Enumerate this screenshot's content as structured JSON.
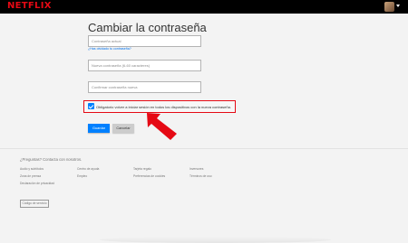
{
  "header": {
    "logo_text": "NETFLIX",
    "avatar_icon": "profile-avatar-icon",
    "menu_icon": "caret-down-icon"
  },
  "form": {
    "title": "Cambiar la contraseña",
    "current_password_placeholder": "Contraseña actual",
    "forgot_link": "¿Has olvidado tu contraseña?",
    "new_password_placeholder": "Nueva contraseña (6-60 caracteres)",
    "confirm_password_placeholder": "Confirmar contraseña nueva",
    "signout_checked": true,
    "signout_label": "Obligatorio volver a iniciar sesión en todos los dispositivos con la nueva contraseña.",
    "save_label": "Guardar",
    "cancel_label": "Cancelar"
  },
  "annotation": {
    "arrow_icon": "red-arrow-icon",
    "arrow_color": "#e50914",
    "highlight_color": "#e50914"
  },
  "footer": {
    "question": "¿Preguntas? Contacta con nosotros.",
    "links": [
      "Audio y subtítulos",
      "Centro de ayuda",
      "Tarjeta regalo",
      "Inversores",
      "Zona de prensa",
      "Empleo",
      "Preferencias de cookies",
      "Términos de uso",
      "Declaración de privacidad"
    ],
    "service_code_label": "Código de servicio"
  },
  "colors": {
    "brand_red": "#e50914",
    "primary_blue": "#0080ff",
    "link_blue": "#0071eb"
  }
}
